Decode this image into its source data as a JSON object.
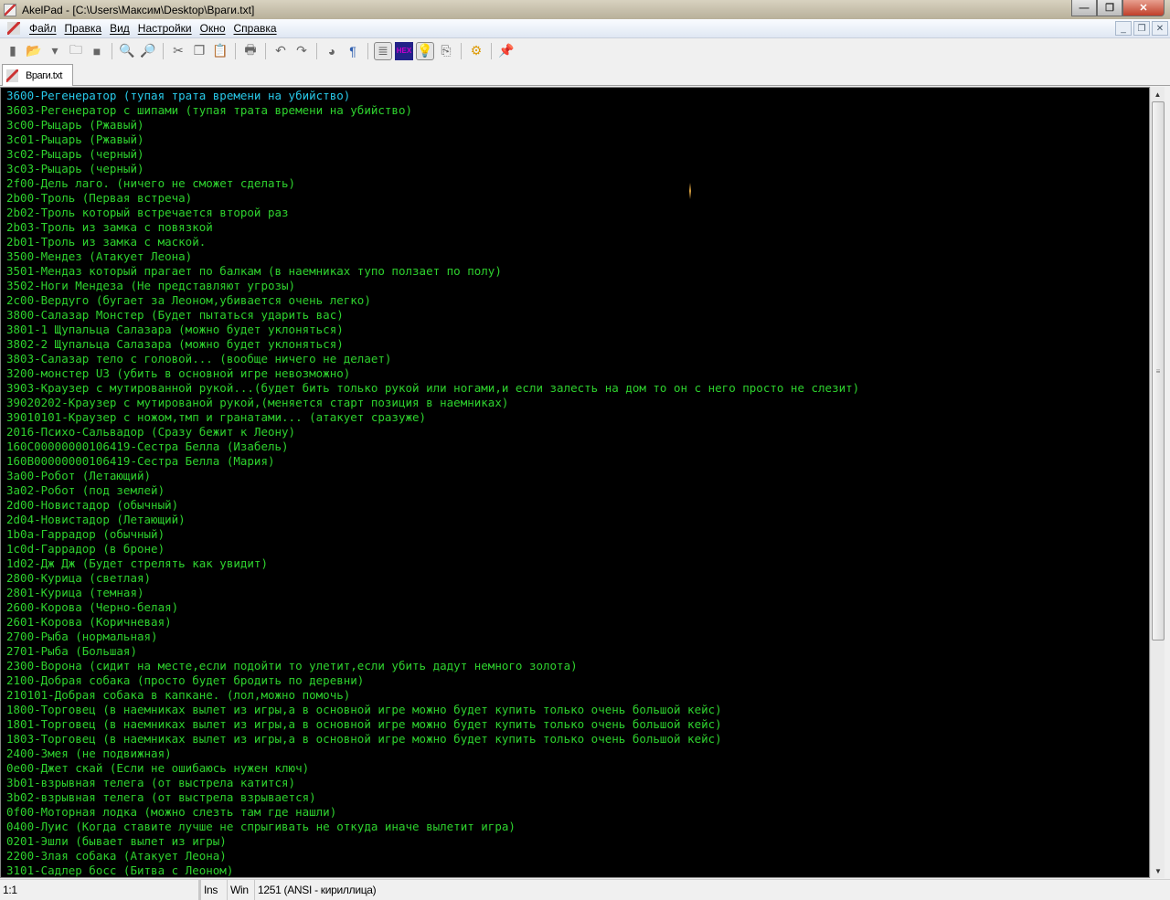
{
  "window": {
    "title": "AkelPad - [C:\\Users\\Максим\\Desktop\\Враги.txt]",
    "min": "—",
    "max": "❐",
    "close": "✕"
  },
  "menu": [
    "Файл",
    "Правка",
    "Вид",
    "Настройки",
    "Окно",
    "Справка"
  ],
  "mdi": {
    "min": "_",
    "restore": "❐",
    "close": "✕"
  },
  "toolbar": [
    {
      "icon": "new-file-icon",
      "glyph": "▮"
    },
    {
      "icon": "open-folder-icon",
      "glyph": "📂"
    },
    {
      "icon": "dropdown-arrow-icon",
      "glyph": "▾"
    },
    {
      "icon": "reopen-folder-icon",
      "glyph": "🗀"
    },
    {
      "icon": "save-icon",
      "glyph": "■"
    },
    {
      "sep": true
    },
    {
      "icon": "find-icon",
      "glyph": "🔍"
    },
    {
      "icon": "replace-icon",
      "glyph": "🔎"
    },
    {
      "sep": true
    },
    {
      "icon": "cut-icon",
      "glyph": "✂"
    },
    {
      "icon": "copy-icon",
      "glyph": "❐"
    },
    {
      "icon": "paste-icon",
      "glyph": "📋"
    },
    {
      "sep": true
    },
    {
      "icon": "print-icon",
      "glyph": "🖶"
    },
    {
      "sep": true
    },
    {
      "icon": "undo-icon",
      "glyph": "↶"
    },
    {
      "icon": "redo-icon",
      "glyph": "↷"
    },
    {
      "sep": true
    },
    {
      "icon": "colors-icon",
      "glyph": "◕"
    },
    {
      "icon": "pilcrow-icon",
      "glyph": "¶"
    },
    {
      "sep": true
    },
    {
      "icon": "word-wrap-icon",
      "glyph": "≣",
      "pressed": true
    },
    {
      "icon": "hex-icon",
      "glyph": "HEX"
    },
    {
      "icon": "lightbulb-icon",
      "glyph": "💡",
      "pressed": true
    },
    {
      "icon": "clipboard-icon",
      "glyph": "⎘"
    },
    {
      "sep": true
    },
    {
      "icon": "settings-gear-icon",
      "glyph": "⚙"
    },
    {
      "sep": true
    },
    {
      "icon": "pin-icon",
      "glyph": "📌"
    }
  ],
  "tab": {
    "label": "Враги.txt"
  },
  "lines": [
    "3600-Регенератор (тупая трата времени на убийство)",
    "3603-Регенератор с шипами (тупая трата времени на убийство)",
    "3c00-Рыцарь (Ржавый)",
    "3c01-Рыцарь (Ржавый)",
    "3c02-Рыцарь (черный)",
    "3c03-Рыцарь (черный)",
    "2f00-Дель лаго. (ничего не сможет сделать)",
    "2b00-Троль (Первая встреча)",
    "2b02-Троль который встречается второй раз",
    "2b03-Троль из замка с повязкой",
    "2b01-Троль из замка с маской.",
    "3500-Мендез (Атакует Леона)",
    "3501-Мендаз который прагает по балкам (в наемниках тупо ползает по полу)",
    "3502-Ноги Мендеза (Не представляют угрозы)",
    "2c00-Вердуго (бугает за Леоном,убивается очень легко)",
    "3800-Салазар Монстер (Будет пытаться ударить вас)",
    "3801-1 Щупальца Салазара (можно будет уклоняться)",
    "3802-2 Щупальца Салазара (можно будет уклоняться)",
    "3803-Салазар тело с головой... (вообще ничего не делает)",
    "3200-монстер U3 (убить в основной игре невозможно)",
    "3903-Краузер с мутированной рукой...(будет бить только рукой или ногами,и если залесть на дом то он с него просто не слезит)",
    "39020202-Краузер с мутированой рукой,(меняется старт позиция в наемниках)",
    "39010101-Краузер с ножом,тмп и гранатами... (атакует сразуже)",
    "2016-Психо-Сальвадор (Сразу бежит к Леону)",
    "160C00000000106419-Сестра Белла (Изабель)",
    "160B00000000106419-Сестра Белла (Мария)",
    "3a00-Робот (Летающий)",
    "3a02-Робот (под землей)",
    "2d00-Новистадор (обычный)",
    "2d04-Новистадор (Летающий)",
    "1b0a-Гаррадор (обычный)",
    "1c0d-Гаррадор (в броне)",
    "1d02-Дж Дж (Будет стрелять как увидит)",
    "2800-Курица (светлая)",
    "2801-Курица (темная)",
    "2600-Корова (Черно-белая)",
    "2601-Корова (Коричневая)",
    "2700-Рыба (нормальная)",
    "2701-Рыба (Большая)",
    "2300-Ворона (сидит на месте,если подойти то улетит,если убить дадут немного золота)",
    "2100-Добрая собака (просто будет бродить по деревни)",
    "210101-Добрая собака в капкане. (лол,можно помочь)",
    "1800-Торговец (в наемниках вылет из игры,а в основной игре можно будет купить только очень большой кейс)",
    "1801-Торговец (в наемниках вылет из игры,а в основной игре можно будет купить только очень большой кейс)",
    "1803-Торговец (в наемниках вылет из игры,а в основной игре можно будет купить только очень большой кейс)",
    "2400-Змея (не подвижная)",
    "0e00-Джет скай (Если не ошибаюсь нужен ключ)",
    "3b01-взрывная телега (от выстрела катится)",
    "3b02-взрывная телега (от выстрела взрывается)",
    "0f00-Моторная лодка (можно слезть там где нашли)",
    "0400-Луис (Когда ставите лучше не спрыгивать не откуда иначе вылетит игра)",
    "0201-Эшли (бывает вылет из игры)",
    "2200-Злая собака (Атакует Леона)",
    "3101-Садлер босс (Битва с Леоном)"
  ],
  "colors": {
    "text": "#2ed22e",
    "current_line": "#28c8e8",
    "background": "#000000"
  },
  "status": {
    "position": "1:1",
    "mode": "Ins",
    "newline": "Win",
    "codepage": "1251  (ANSI - кириллица)"
  }
}
